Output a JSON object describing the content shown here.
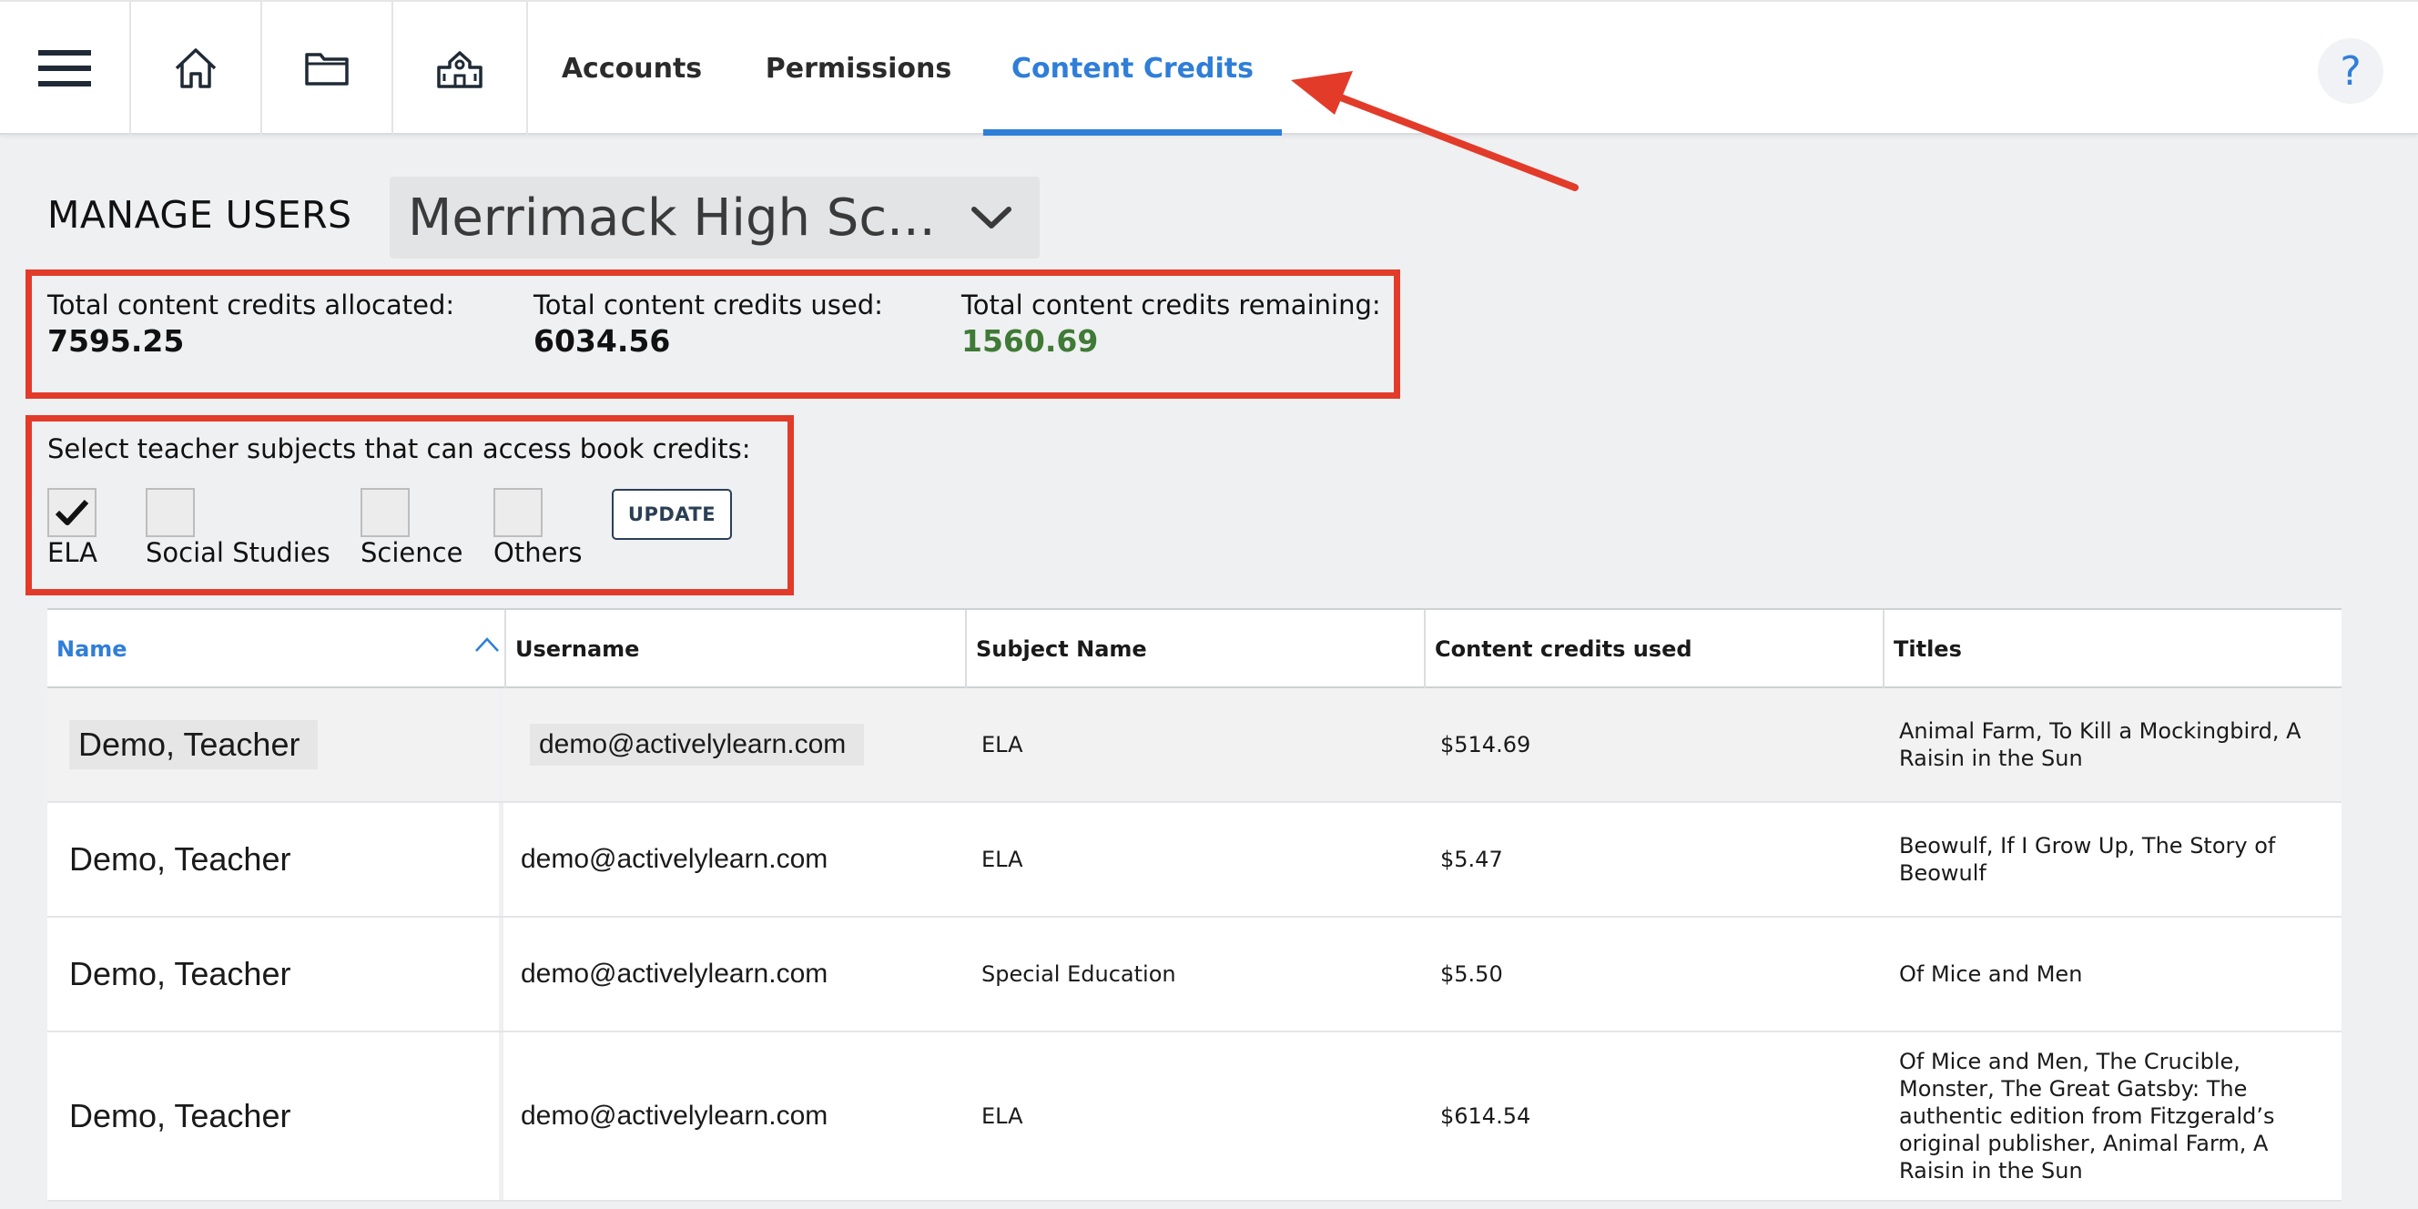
{
  "nav": {
    "tabs": [
      {
        "label": "Accounts"
      },
      {
        "label": "Permissions"
      },
      {
        "label": "Content Credits"
      }
    ],
    "help": "?"
  },
  "manage": {
    "title": "MANAGE USERS",
    "school": "Merrimack High Sc..."
  },
  "credits": {
    "allocated_label": "Total content credits allocated:",
    "allocated_value": "7595.25",
    "used_label": "Total content credits used:",
    "used_value": "6034.56",
    "remaining_label": "Total content credits remaining:",
    "remaining_value": "1560.69"
  },
  "subjects": {
    "title": "Select teacher subjects that can access book credits:",
    "options": [
      {
        "label": "ELA",
        "checked": true
      },
      {
        "label": "Social Studies",
        "checked": false
      },
      {
        "label": "Science",
        "checked": false
      },
      {
        "label": "Others",
        "checked": false
      }
    ],
    "update_label": "UPDATE"
  },
  "table": {
    "columns": [
      "Name",
      "Username",
      "Subject Name",
      "Content credits used",
      "Titles"
    ],
    "rows": [
      {
        "name": "Demo, Teacher",
        "username": "demo@activelylearn.com",
        "subject": "ELA",
        "credits": "$514.69",
        "titles": "Animal Farm, To Kill a Mockingbird, A Raisin in the Sun"
      },
      {
        "name": "Demo, Teacher",
        "username": "demo@activelylearn.com",
        "subject": "ELA",
        "credits": "$5.47",
        "titles": "Beowulf, If I Grow Up, The Story of Beowulf"
      },
      {
        "name": "Demo, Teacher",
        "username": "demo@activelylearn.com",
        "subject": "Special Education",
        "credits": "$5.50",
        "titles": "Of Mice and Men"
      },
      {
        "name": "Demo, Teacher",
        "username": "demo@activelylearn.com",
        "subject": "ELA",
        "credits": "$614.54",
        "titles": "Of Mice and Men, The Crucible, Monster, The Great Gatsby: The authentic edition from Fitzgerald’s original publisher, Animal Farm, A Raisin in the Sun"
      }
    ]
  },
  "colors": {
    "accent": "#2f7ed8",
    "annotation": "#e23b2a",
    "remaining": "#3f7a36"
  }
}
